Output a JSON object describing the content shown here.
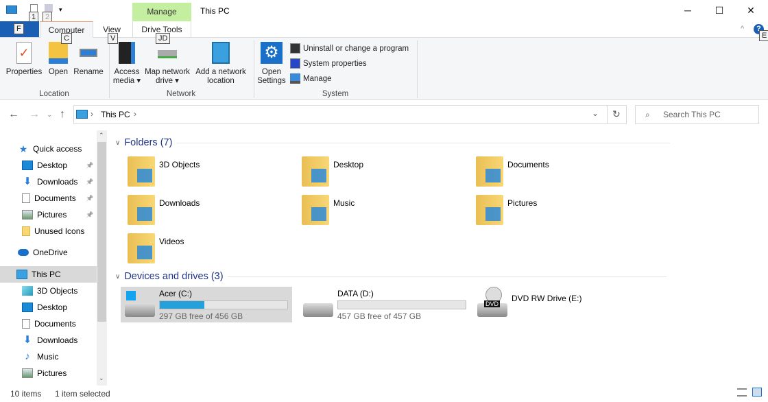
{
  "window": {
    "title": "This PC",
    "contextual_group": "Manage",
    "minimize": "─",
    "maximize": "☐",
    "close": "✕"
  },
  "keytips": {
    "qat1": "1",
    "qat2": "2",
    "file": "F",
    "computer": "C",
    "view": "V",
    "drivetools": "JD",
    "help": "E"
  },
  "tabs": {
    "file": "F",
    "computer": "Computer",
    "view": "View",
    "drive_tools": "Drive Tools"
  },
  "ribbon": {
    "location": {
      "label": "Location",
      "properties": "Properties",
      "open": "Open",
      "rename": "Rename"
    },
    "network": {
      "label": "Network",
      "access_media": "Access media",
      "map_drive": "Map network drive",
      "add_location": "Add a network location"
    },
    "system": {
      "label": "System",
      "open_settings": "Open Settings",
      "uninstall": "Uninstall or change a program",
      "system_properties": "System properties",
      "manage": "Manage"
    }
  },
  "address": {
    "crumb": "This PC",
    "search_placeholder": "Search This PC"
  },
  "sidebar": {
    "items": [
      {
        "label": "Quick access",
        "icon": "star-icon",
        "level": 0
      },
      {
        "label": "Desktop",
        "icon": "desktop-icon",
        "level": 1,
        "pinned": true
      },
      {
        "label": "Downloads",
        "icon": "download-icon",
        "level": 1,
        "pinned": true
      },
      {
        "label": "Documents",
        "icon": "document-icon",
        "level": 1,
        "pinned": true
      },
      {
        "label": "Pictures",
        "icon": "pictures-icon",
        "level": 1,
        "pinned": true
      },
      {
        "label": "Unused Icons",
        "icon": "folder-icon",
        "level": 1
      },
      {
        "label": "OneDrive",
        "icon": "cloud-icon",
        "level": 0
      },
      {
        "label": "This PC",
        "icon": "computer-icon",
        "level": 0,
        "selected": true
      },
      {
        "label": "3D Objects",
        "icon": "cube-icon",
        "level": 1
      },
      {
        "label": "Desktop",
        "icon": "desktop-icon",
        "level": 1
      },
      {
        "label": "Documents",
        "icon": "document-icon",
        "level": 1
      },
      {
        "label": "Downloads",
        "icon": "download-icon",
        "level": 1
      },
      {
        "label": "Music",
        "icon": "music-icon",
        "level": 1
      },
      {
        "label": "Pictures",
        "icon": "pictures-icon",
        "level": 1
      }
    ]
  },
  "folders": {
    "header": "Folders (7)",
    "items": [
      {
        "label": "3D Objects",
        "icon": "cube-icon"
      },
      {
        "label": "Desktop",
        "icon": "desktop-icon"
      },
      {
        "label": "Documents",
        "icon": "document-icon"
      },
      {
        "label": "Downloads",
        "icon": "download-icon"
      },
      {
        "label": "Music",
        "icon": "music-icon"
      },
      {
        "label": "Pictures",
        "icon": "pictures-icon"
      },
      {
        "label": "Videos",
        "icon": "video-icon"
      }
    ]
  },
  "drives": {
    "header": "Devices and drives (3)",
    "items": [
      {
        "label": "Acer (C:)",
        "free": "297 GB free of 456 GB",
        "used_fraction": 0.349,
        "selected": true,
        "icon": "windows-drive-icon"
      },
      {
        "label": "DATA (D:)",
        "free": "457 GB free of 457 GB",
        "used_fraction": 0.0,
        "icon": "drive-icon"
      },
      {
        "label": "DVD RW Drive (E:)",
        "icon": "dvd-drive-icon"
      }
    ]
  },
  "status": {
    "count": "10 items",
    "selected": "1 item selected"
  },
  "colors": {
    "accent": "#1a5fb4",
    "manage_tab": "#c4eea0",
    "selection": "#d9d9d9",
    "progress": "#26a0da",
    "header_text": "#1e3287"
  }
}
